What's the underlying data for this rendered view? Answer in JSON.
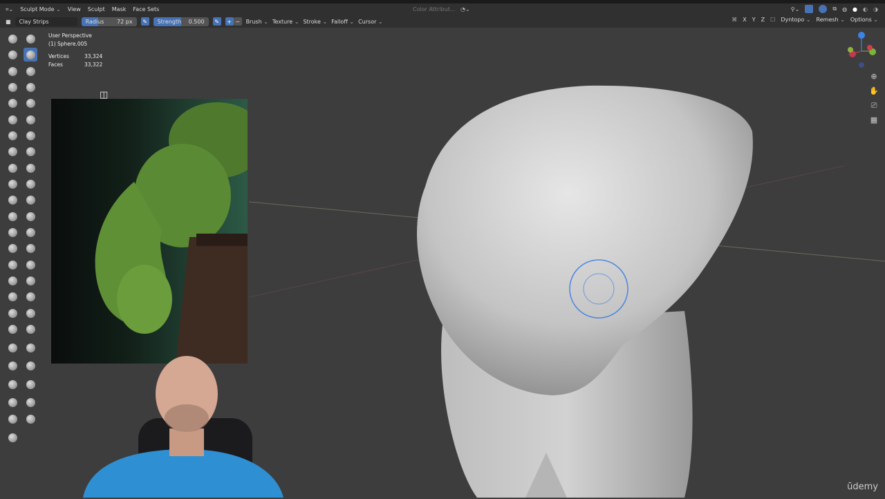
{
  "header": {
    "mode": "Sculpt Mode",
    "menus": [
      "View",
      "Sculpt",
      "Mask",
      "Face Sets"
    ],
    "color_attribute": "Color Attribut..."
  },
  "tool_header": {
    "brush_name": "Clay Strips",
    "radius_label": "Radius",
    "radius_value": "72 px",
    "strength_label": "Strength",
    "strength_value": "0.500",
    "strength_fraction": 0.5,
    "plus": "+",
    "minus": "−",
    "menus": [
      "Brush",
      "Texture",
      "Stroke",
      "Falloff",
      "Cursor"
    ],
    "symmetry": [
      "X",
      "Y",
      "Z"
    ],
    "right_menus": [
      "Dyntopo",
      "Remesh",
      "Options"
    ]
  },
  "viewport": {
    "view_name": "User Perspective",
    "object": "(1) Sphere.005",
    "stats": [
      {
        "label": "Vertices",
        "value": "33,324"
      },
      {
        "label": "Faces",
        "value": "33,322"
      }
    ]
  },
  "watermark": "ūdemy",
  "colors": {
    "accent": "#4772b3",
    "background": "#3d3d3d",
    "header": "#303030"
  }
}
